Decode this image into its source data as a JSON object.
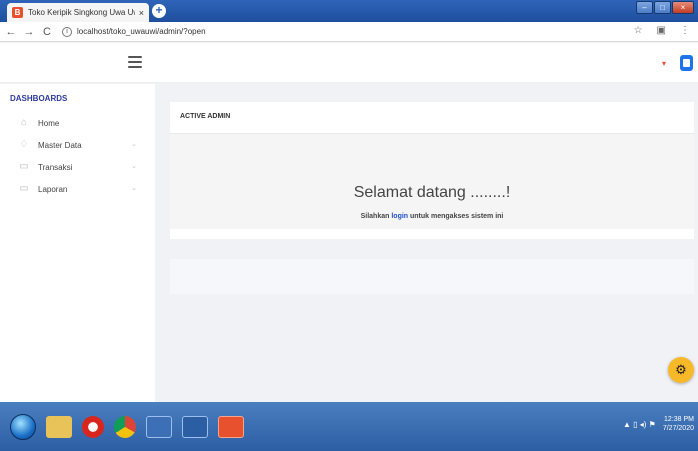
{
  "browser": {
    "tab_title": "Toko Keripik Singkong Uwa Uw",
    "tab_favicon": "B",
    "tab_close": "×",
    "new_tab": "+",
    "url": "localhost/toko_uwauwi/admin/?open",
    "back": "←",
    "forward": "→",
    "reload": "C",
    "info": "i",
    "star": "☆",
    "ext": "▣",
    "menu": "⋮"
  },
  "window_controls": {
    "minimize": "–",
    "maximize": "□",
    "close": "×"
  },
  "navbar": {
    "caret": "▾"
  },
  "sidebar": {
    "heading": "DASHBOARDS",
    "items": [
      {
        "label": "Home",
        "icon": "home-icon",
        "glyph": "⌂",
        "has_chevron": false
      },
      {
        "label": "Master Data",
        "icon": "diamond-icon",
        "glyph": "♢",
        "has_chevron": true
      },
      {
        "label": "Transaksi",
        "icon": "monitor-icon",
        "glyph": "▭",
        "has_chevron": true
      },
      {
        "label": "Laporan",
        "icon": "monitor-icon",
        "glyph": "▭",
        "has_chevron": true
      }
    ],
    "chevron": "⌄"
  },
  "card": {
    "header": "ACTIVE ADMIN",
    "welcome": "Selamat datang ........!",
    "sub_prefix": "Silahkan ",
    "sub_link": "login",
    "sub_suffix": " untuk mengakses sistem ini"
  },
  "settings_button": {
    "glyph": "⚙"
  },
  "taskbar": {
    "clock_time": "12:38 PM",
    "clock_date": "7/27/2020",
    "tray": "▲  ▯  ◂)  ⚑"
  },
  "colors": {
    "accent": "#1e4fc7",
    "sidebar_heading": "#2d3a9b",
    "fab": "#f7b928",
    "badge": "#1e73e8"
  }
}
